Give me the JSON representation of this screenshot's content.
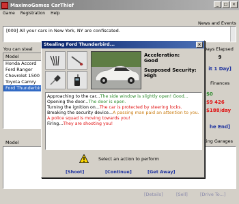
{
  "window": {
    "title": "MaximoGames CarThief",
    "btn_min": "_",
    "btn_max": "□",
    "btn_close": "×"
  },
  "menu": [
    "Game",
    "Registration",
    "Help"
  ],
  "news": {
    "header": "News and Events",
    "text": "[009] All your cars in New York, NY are confiscated."
  },
  "left": {
    "you_can_steal": "You can steal",
    "model_header": "Model",
    "cars": [
      "Honda Accord",
      "Ford Ranger",
      "Chevrolet 1500",
      "Toyota Camry",
      "Ford Thunderbird"
    ],
    "selected_index": 4
  },
  "right": {
    "days_elapsed_label": "Days Elapsed",
    "days_elapsed_value": "9",
    "wait_btn": "it 1 Day]",
    "finances_label": "Finances",
    "fin1": "$0",
    "fin2": "$9 426",
    "fin3": "$188/day",
    "end_btn": "he End]",
    "parking_label": "king Garages"
  },
  "bottom": {
    "model_label": "Model",
    "btn_details": "[Details]",
    "btn_sell": "[Sell]",
    "btn_drive": "[Drive To...]"
  },
  "dialog": {
    "title": "Stealing Ford Thunderbird...",
    "close": "×",
    "acceleration_label": "Acceleration:",
    "acceleration_value": "Good",
    "security_label": "Supposed Security:",
    "security_value": "High",
    "log": [
      {
        "a": "Approaching to the car...",
        "b": "The side window is slightly open! Good...",
        "bc": "green"
      },
      {
        "a": "Opening the door...",
        "b": "The door is open.",
        "bc": "green"
      },
      {
        "a": "Turning the ignition on...",
        "b": "The car is protected by steering locks.",
        "bc": "red"
      },
      {
        "a": "Breaking the security device...",
        "b": "A passing man paid an attention to you.",
        "bc": "orange"
      },
      {
        "a": "",
        "b": "A police squad is moving towards you!",
        "bc": "red"
      },
      {
        "a": "Firing...",
        "b": "They are shooting you!",
        "bc": "red"
      }
    ],
    "prompt": "Select an action to perform",
    "actions": [
      "[Shoot]",
      "[Continue]",
      "[Get Away]"
    ]
  }
}
